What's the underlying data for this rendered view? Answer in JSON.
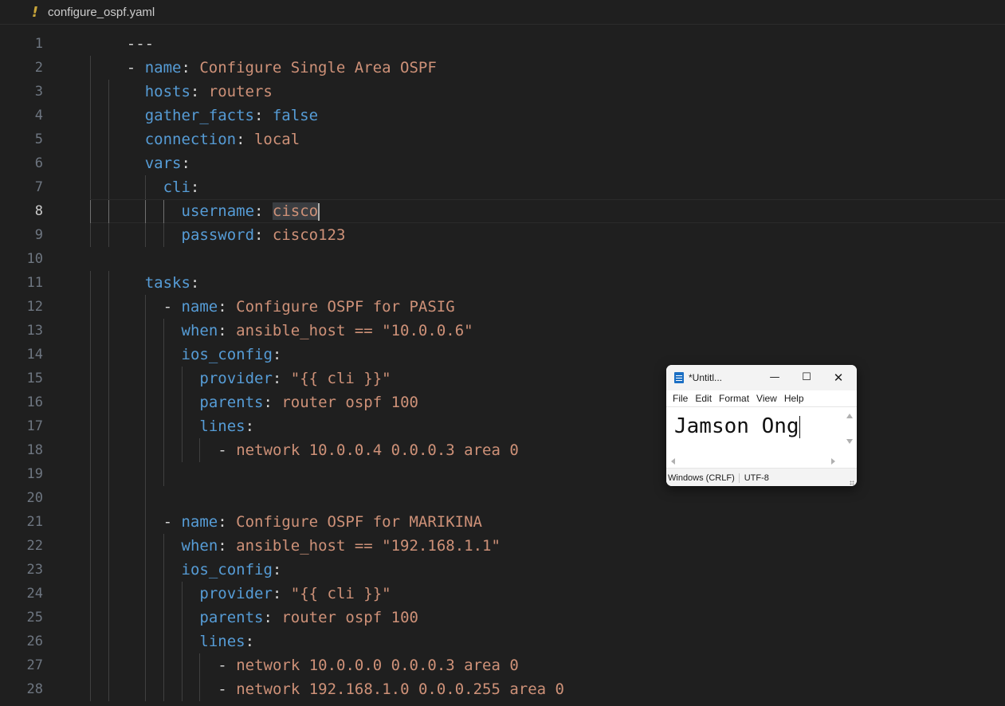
{
  "editor": {
    "tab": {
      "icon": "!",
      "filename": "configure_ospf.yaml"
    },
    "active_line": 8,
    "lines": [
      {
        "n": "1",
        "indent": 4,
        "guides": [],
        "tokens": [
          [
            "p",
            "---"
          ]
        ]
      },
      {
        "n": "2",
        "indent": 4,
        "guides": [
          0
        ],
        "tokens": [
          [
            "p",
            "- "
          ],
          [
            "k",
            "name"
          ],
          [
            "p",
            ": "
          ],
          [
            "s",
            "Configure Single Area OSPF"
          ]
        ]
      },
      {
        "n": "3",
        "indent": 6,
        "guides": [
          0,
          2
        ],
        "tokens": [
          [
            "k",
            "hosts"
          ],
          [
            "p",
            ": "
          ],
          [
            "s",
            "routers"
          ]
        ]
      },
      {
        "n": "4",
        "indent": 6,
        "guides": [
          0,
          2
        ],
        "tokens": [
          [
            "k",
            "gather_facts"
          ],
          [
            "p",
            ": "
          ],
          [
            "k",
            "false"
          ]
        ]
      },
      {
        "n": "5",
        "indent": 6,
        "guides": [
          0,
          2
        ],
        "tokens": [
          [
            "k",
            "connection"
          ],
          [
            "p",
            ": "
          ],
          [
            "s",
            "local"
          ]
        ]
      },
      {
        "n": "6",
        "indent": 6,
        "guides": [
          0,
          2
        ],
        "tokens": [
          [
            "k",
            "vars"
          ],
          [
            "p",
            ":"
          ]
        ]
      },
      {
        "n": "7",
        "indent": 8,
        "guides": [
          0,
          2,
          6
        ],
        "tokens": [
          [
            "k",
            "cli"
          ],
          [
            "p",
            ":"
          ]
        ]
      },
      {
        "n": "8",
        "indent": 10,
        "guides": [
          0,
          2,
          6,
          8
        ],
        "tokens": [
          [
            "k",
            "username"
          ],
          [
            "p",
            ": "
          ],
          [
            "sel",
            "cisco"
          ],
          [
            "cursor",
            ""
          ]
        ]
      },
      {
        "n": "9",
        "indent": 10,
        "guides": [
          0,
          2,
          6,
          8
        ],
        "tokens": [
          [
            "k",
            "password"
          ],
          [
            "p",
            ": "
          ],
          [
            "s",
            "cisco123"
          ]
        ]
      },
      {
        "n": "10",
        "indent": 0,
        "guides": [],
        "tokens": []
      },
      {
        "n": "11",
        "indent": 6,
        "guides": [
          0,
          2
        ],
        "tokens": [
          [
            "k",
            "tasks"
          ],
          [
            "p",
            ":"
          ]
        ]
      },
      {
        "n": "12",
        "indent": 8,
        "guides": [
          0,
          2,
          6
        ],
        "tokens": [
          [
            "p",
            "- "
          ],
          [
            "k",
            "name"
          ],
          [
            "p",
            ": "
          ],
          [
            "s",
            "Configure OSPF for PASIG"
          ]
        ]
      },
      {
        "n": "13",
        "indent": 10,
        "guides": [
          0,
          2,
          6,
          8
        ],
        "tokens": [
          [
            "k",
            "when"
          ],
          [
            "p",
            ": "
          ],
          [
            "s",
            "ansible_host == \"10.0.0.6\""
          ]
        ]
      },
      {
        "n": "14",
        "indent": 10,
        "guides": [
          0,
          2,
          6,
          8
        ],
        "tokens": [
          [
            "k",
            "ios_config"
          ],
          [
            "p",
            ":"
          ]
        ]
      },
      {
        "n": "15",
        "indent": 12,
        "guides": [
          0,
          2,
          6,
          8,
          10
        ],
        "tokens": [
          [
            "k",
            "provider"
          ],
          [
            "p",
            ": "
          ],
          [
            "s",
            "\"{{ cli }}\""
          ]
        ]
      },
      {
        "n": "16",
        "indent": 12,
        "guides": [
          0,
          2,
          6,
          8,
          10
        ],
        "tokens": [
          [
            "k",
            "parents"
          ],
          [
            "p",
            ": "
          ],
          [
            "s",
            "router ospf 100"
          ]
        ]
      },
      {
        "n": "17",
        "indent": 12,
        "guides": [
          0,
          2,
          6,
          8,
          10
        ],
        "tokens": [
          [
            "k",
            "lines"
          ],
          [
            "p",
            ":"
          ]
        ]
      },
      {
        "n": "18",
        "indent": 14,
        "guides": [
          0,
          2,
          6,
          8,
          10,
          12
        ],
        "tokens": [
          [
            "p",
            "- "
          ],
          [
            "s",
            "network 10.0.0.4 0.0.0.3 area 0"
          ]
        ]
      },
      {
        "n": "19",
        "indent": 0,
        "guides": [
          0,
          2,
          6,
          8
        ],
        "tokens": []
      },
      {
        "n": "20",
        "indent": 0,
        "guides": [
          0,
          2,
          6
        ],
        "tokens": []
      },
      {
        "n": "21",
        "indent": 8,
        "guides": [
          0,
          2,
          6
        ],
        "tokens": [
          [
            "p",
            "- "
          ],
          [
            "k",
            "name"
          ],
          [
            "p",
            ": "
          ],
          [
            "s",
            "Configure OSPF for MARIKINA"
          ]
        ]
      },
      {
        "n": "22",
        "indent": 10,
        "guides": [
          0,
          2,
          6,
          8
        ],
        "tokens": [
          [
            "k",
            "when"
          ],
          [
            "p",
            ": "
          ],
          [
            "s",
            "ansible_host == \"192.168.1.1\""
          ]
        ]
      },
      {
        "n": "23",
        "indent": 10,
        "guides": [
          0,
          2,
          6,
          8
        ],
        "tokens": [
          [
            "k",
            "ios_config"
          ],
          [
            "p",
            ":"
          ]
        ]
      },
      {
        "n": "24",
        "indent": 12,
        "guides": [
          0,
          2,
          6,
          8,
          10
        ],
        "tokens": [
          [
            "k",
            "provider"
          ],
          [
            "p",
            ": "
          ],
          [
            "s",
            "\"{{ cli }}\""
          ]
        ]
      },
      {
        "n": "25",
        "indent": 12,
        "guides": [
          0,
          2,
          6,
          8,
          10
        ],
        "tokens": [
          [
            "k",
            "parents"
          ],
          [
            "p",
            ": "
          ],
          [
            "s",
            "router ospf 100"
          ]
        ]
      },
      {
        "n": "26",
        "indent": 12,
        "guides": [
          0,
          2,
          6,
          8,
          10
        ],
        "tokens": [
          [
            "k",
            "lines"
          ],
          [
            "p",
            ":"
          ]
        ]
      },
      {
        "n": "27",
        "indent": 14,
        "guides": [
          0,
          2,
          6,
          8,
          10,
          12
        ],
        "tokens": [
          [
            "p",
            "- "
          ],
          [
            "s",
            "network 10.0.0.0 0.0.0.3 area 0"
          ]
        ]
      },
      {
        "n": "28",
        "indent": 14,
        "guides": [
          0,
          2,
          6,
          8,
          10,
          12
        ],
        "tokens": [
          [
            "p",
            "- "
          ],
          [
            "s",
            "network 192.168.1.0 0.0.0.255 area 0"
          ]
        ]
      }
    ]
  },
  "notepad": {
    "title": "*Untitl...",
    "controls": {
      "minimize": "—",
      "maximize": "☐",
      "close": "✕"
    },
    "menu": [
      "File",
      "Edit",
      "Format",
      "View",
      "Help"
    ],
    "content": "Jamson Ong",
    "status": {
      "line_ending": "Windows (CRLF)",
      "encoding": "UTF-8"
    }
  }
}
